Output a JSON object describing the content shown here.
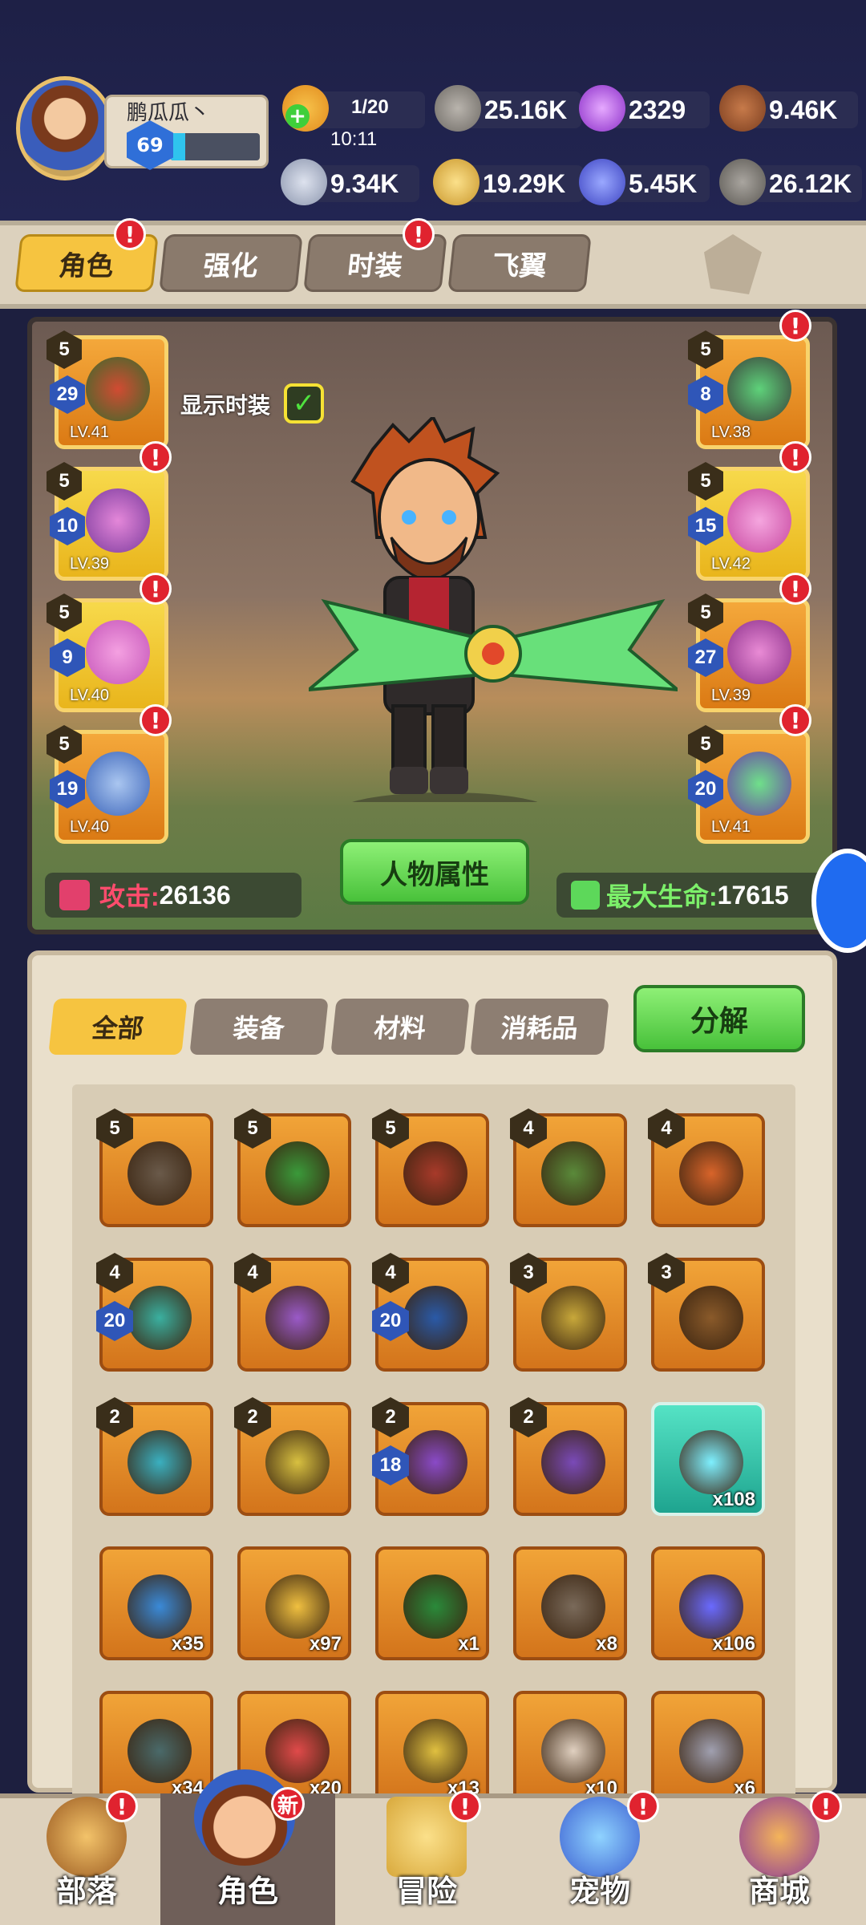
{
  "player": {
    "name": "鹏瓜瓜丶",
    "level": "69",
    "xp_fraction": 0.17
  },
  "resources": [
    {
      "id": "stamina",
      "value": "1/20",
      "sub": "10:11",
      "icon": "stamina-drumstick-icon"
    },
    {
      "id": "ore",
      "value": "25.16K",
      "icon": "ore-icon"
    },
    {
      "id": "orb",
      "value": "2329",
      "icon": "purple-orb-icon"
    },
    {
      "id": "wood",
      "value": "9.46K",
      "icon": "wood-log-icon"
    },
    {
      "id": "bone",
      "value": "9.34K",
      "icon": "bone-icon"
    },
    {
      "id": "coin",
      "value": "19.29K",
      "icon": "gold-coin-icon"
    },
    {
      "id": "gem",
      "value": "5.45K",
      "icon": "blue-gem-icon"
    },
    {
      "id": "stone",
      "value": "26.12K",
      "icon": "stone-icon"
    }
  ],
  "top_tabs": [
    {
      "label": "角色",
      "alert": true
    },
    {
      "label": "强化",
      "alert": false
    },
    {
      "label": "时装",
      "alert": true
    },
    {
      "label": "飞翼",
      "alert": false
    }
  ],
  "show_costume": {
    "label": "显示时装",
    "checked": true
  },
  "equip_left": [
    {
      "star": "5",
      "qty": "29",
      "lv": "LV.41",
      "alert": false
    },
    {
      "star": "5",
      "qty": "10",
      "lv": "LV.39",
      "alert": true
    },
    {
      "star": "5",
      "qty": "9",
      "lv": "LV.40",
      "alert": true
    },
    {
      "star": "5",
      "qty": "19",
      "lv": "LV.40",
      "alert": true
    }
  ],
  "equip_right": [
    {
      "star": "5",
      "qty": "8",
      "lv": "LV.38",
      "alert": true
    },
    {
      "star": "5",
      "qty": "15",
      "lv": "LV.42",
      "alert": true
    },
    {
      "star": "5",
      "qty": "27",
      "lv": "LV.39",
      "alert": true
    },
    {
      "star": "5",
      "qty": "20",
      "lv": "LV.41",
      "alert": true
    }
  ],
  "stats": {
    "attack_label": "攻击:",
    "attack": "26136",
    "hp_label": "最大生命:",
    "hp": "17615",
    "attr_button": "人物属性"
  },
  "filter_tabs": [
    "全部",
    "装备",
    "材料",
    "消耗品"
  ],
  "decompose_button": "分解",
  "items": [
    {
      "star": "5",
      "qty": "",
      "count": ""
    },
    {
      "star": "5",
      "qty": "",
      "count": ""
    },
    {
      "star": "5",
      "qty": "",
      "count": ""
    },
    {
      "star": "4",
      "qty": "",
      "count": ""
    },
    {
      "star": "4",
      "qty": "",
      "count": ""
    },
    {
      "star": "4",
      "qty": "20",
      "count": ""
    },
    {
      "star": "4",
      "qty": "",
      "count": ""
    },
    {
      "star": "4",
      "qty": "20",
      "count": ""
    },
    {
      "star": "3",
      "qty": "",
      "count": ""
    },
    {
      "star": "3",
      "qty": "",
      "count": ""
    },
    {
      "star": "2",
      "qty": "",
      "count": ""
    },
    {
      "star": "2",
      "qty": "",
      "count": ""
    },
    {
      "star": "2",
      "qty": "18",
      "count": ""
    },
    {
      "star": "2",
      "qty": "",
      "count": ""
    },
    {
      "star": "",
      "qty": "",
      "count": "x108"
    },
    {
      "star": "",
      "qty": "",
      "count": "x35"
    },
    {
      "star": "",
      "qty": "",
      "count": "x97"
    },
    {
      "star": "",
      "qty": "",
      "count": "x1"
    },
    {
      "star": "",
      "qty": "",
      "count": "x8"
    },
    {
      "star": "",
      "qty": "",
      "count": "x106"
    },
    {
      "star": "",
      "qty": "",
      "count": "x34"
    },
    {
      "star": "",
      "qty": "",
      "count": "x20"
    },
    {
      "star": "",
      "qty": "",
      "count": "x13"
    },
    {
      "star": "",
      "qty": "",
      "count": "x10"
    },
    {
      "star": "",
      "qty": "",
      "count": "x6"
    }
  ],
  "nav": [
    {
      "label": "部落",
      "alert": true,
      "badge": ""
    },
    {
      "label": "角色",
      "alert": false,
      "badge": "新"
    },
    {
      "label": "冒险",
      "alert": true,
      "badge": ""
    },
    {
      "label": "宠物",
      "alert": true,
      "badge": ""
    },
    {
      "label": "商城",
      "alert": true,
      "badge": ""
    }
  ],
  "colors": {
    "accent": "#f6c440",
    "alert": "#e0232f",
    "green": "#48c13a"
  }
}
